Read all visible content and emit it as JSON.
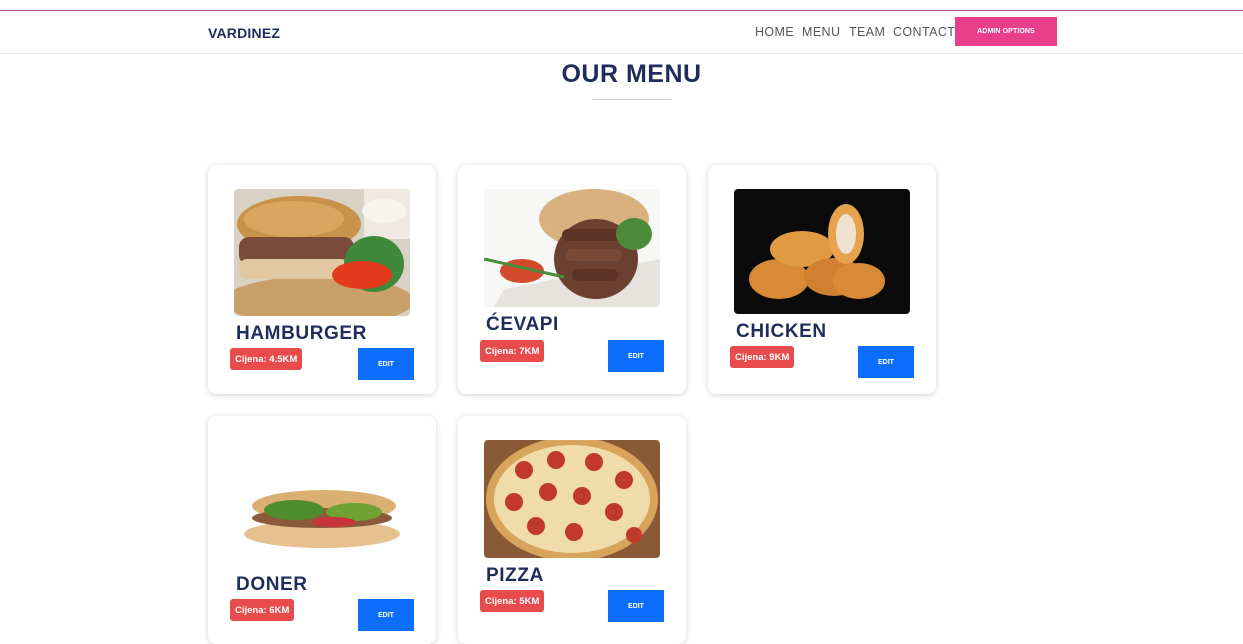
{
  "navbar": {
    "brand": "VARDINEZ",
    "links": [
      "HOME",
      "MENU",
      "TEAM",
      "CONTACT"
    ],
    "admin_button": "ADMIN OPTIONS"
  },
  "page": {
    "title": "OUR MENU"
  },
  "menu": [
    {
      "name": "HAMBURGER",
      "price": "Cijena: 4.5KM",
      "edit": "EDIT",
      "image": "hamburger-photo"
    },
    {
      "name": "ĆEVAPI",
      "price": "Cijena: 7KM",
      "edit": "EDIT",
      "image": "cevapi-photo"
    },
    {
      "name": "CHICKEN",
      "price": "Cijena: 9KM",
      "edit": "EDIT",
      "image": "chicken-nuggets-photo"
    },
    {
      "name": "DONER",
      "price": "Cijena: 6KM",
      "edit": "EDIT",
      "image": "doner-photo"
    },
    {
      "name": "PIZZA",
      "price": "Cijena: 5KM",
      "edit": "EDIT",
      "image": "pizza-photo"
    }
  ],
  "colors": {
    "accent": "#e83e8c",
    "primary": "#0d6efd",
    "price_badge": "#e84b4b",
    "text_dark": "#1f2d5c"
  }
}
